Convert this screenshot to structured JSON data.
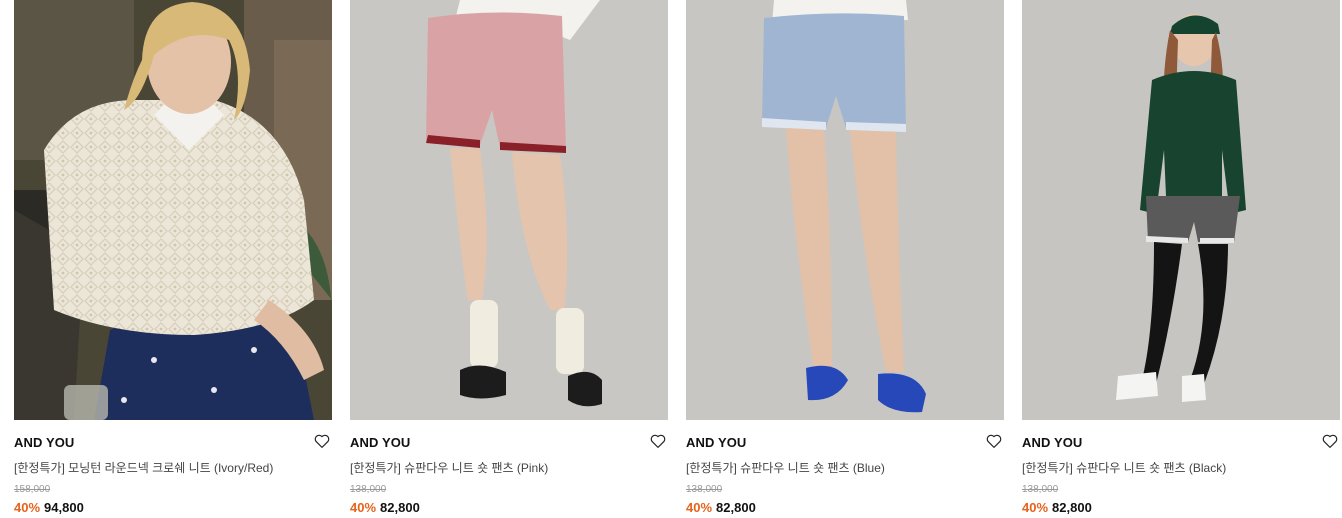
{
  "accent": "#e8621c",
  "products": [
    {
      "brand": "AND YOU",
      "name": "[한정특가] 모닝턴 라운드넥 크로쉐 니트 (Ivory/Red)",
      "original_price": "158,000",
      "discount": "40%",
      "price": "94,800",
      "wishlist_icon": "heart-outline-icon"
    },
    {
      "brand": "AND YOU",
      "name": "[한정특가] 슈판다우 니트 숏 팬츠 (Pink)",
      "original_price": "138,000",
      "discount": "40%",
      "price": "82,800",
      "wishlist_icon": "heart-outline-icon"
    },
    {
      "brand": "AND YOU",
      "name": "[한정특가] 슈판다우 니트 숏 팬츠 (Blue)",
      "original_price": "138,000",
      "discount": "40%",
      "price": "82,800",
      "wishlist_icon": "heart-outline-icon"
    },
    {
      "brand": "AND YOU",
      "name": "[한정특가] 슈판다우 니트 숏 팬츠 (Black)",
      "original_price": "138,000",
      "discount": "40%",
      "price": "82,800",
      "wishlist_icon": "heart-outline-icon"
    }
  ]
}
